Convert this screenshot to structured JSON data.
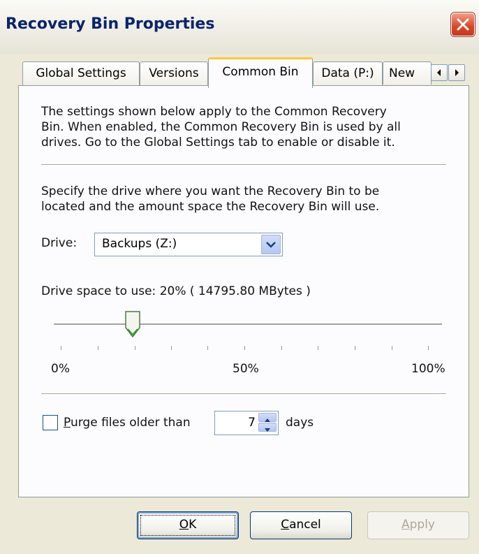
{
  "window": {
    "title": "Recovery Bin Properties",
    "close_icon": "close-icon"
  },
  "tabs": [
    {
      "label": "Global Settings"
    },
    {
      "label": "Versions"
    },
    {
      "label": "Common Bin"
    },
    {
      "label": "Data (P:)"
    },
    {
      "label": "New"
    }
  ],
  "active_tab": "Common Bin",
  "panel": {
    "intro_line1": "The settings shown below apply to the Common Recovery",
    "intro_line2": "Bin.  When enabled, the Common Recovery Bin is used by all",
    "intro_line3": "drives.  Go to the Global Settings tab to enable or disable it.",
    "specify_line1": "Specify the drive where you want the Recovery Bin to be",
    "specify_line2": "located and the amount space the Recovery Bin will use.",
    "drive_label": "Drive:",
    "drive_value": "Backups (Z:)",
    "space_label": "Drive space to use:  20%   ( 14795.80 MBytes )",
    "slider_value_percent": 20,
    "slider_min_label": "0%",
    "slider_mid_label": "50%",
    "slider_max_label": "100%",
    "purge_checked": false,
    "purge_label_underlined": "P",
    "purge_label_rest": "urge files older than",
    "purge_days_value": "7",
    "purge_days_unit": "days"
  },
  "buttons": {
    "ok_u": "O",
    "ok_rest": "K",
    "cancel_u": "C",
    "cancel_rest": "ancel",
    "apply_u": "A",
    "apply_rest": "pply"
  }
}
